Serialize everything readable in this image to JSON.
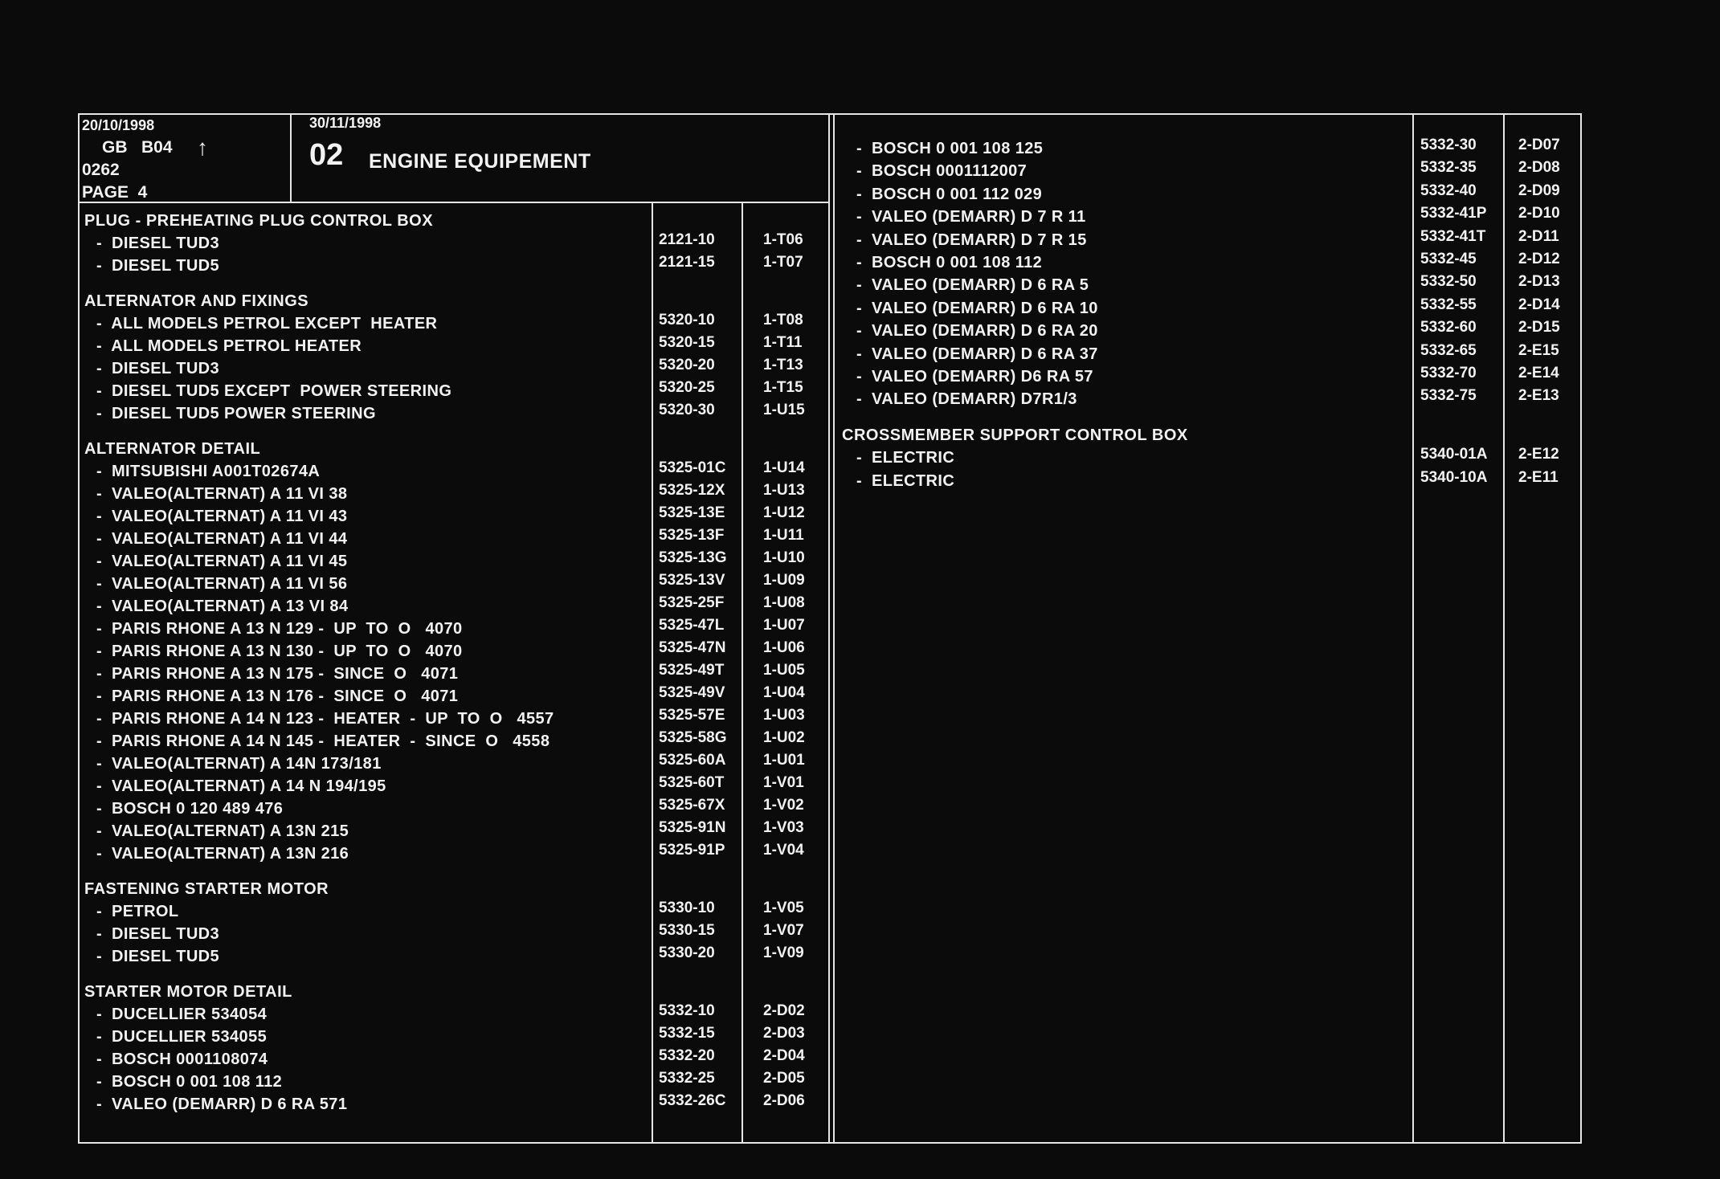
{
  "header": {
    "date_left": "20/10/1998",
    "lang_line": "GB   B04",
    "arrow": "↑",
    "code": "0262",
    "page": "PAGE  4",
    "date_right": "30/11/1998",
    "section_num": "02",
    "section_title": "ENGINE EQUIPEMENT"
  },
  "left_column": [
    {
      "type": "section",
      "text": "PLUG - PREHEATING PLUG CONTROL BOX"
    },
    {
      "type": "item",
      "text": "-  DIESEL TUD3",
      "ref": "2121-10",
      "code": "1-T06"
    },
    {
      "type": "item",
      "text": "-  DIESEL TUD5",
      "ref": "2121-15",
      "code": "1-T07"
    },
    {
      "type": "section",
      "text": "ALTERNATOR AND FIXINGS"
    },
    {
      "type": "item",
      "text": "-  ALL MODELS PETROL EXCEPT  HEATER",
      "ref": "5320-10",
      "code": "1-T08"
    },
    {
      "type": "item",
      "text": "-  ALL MODELS PETROL HEATER",
      "ref": "5320-15",
      "code": "1-T11"
    },
    {
      "type": "item",
      "text": "-  DIESEL TUD3",
      "ref": "5320-20",
      "code": "1-T13"
    },
    {
      "type": "item",
      "text": "-  DIESEL TUD5 EXCEPT  POWER STEERING",
      "ref": "5320-25",
      "code": "1-T15"
    },
    {
      "type": "item",
      "text": "-  DIESEL TUD5 POWER STEERING",
      "ref": "5320-30",
      "code": "1-U15"
    },
    {
      "type": "section",
      "text": "ALTERNATOR DETAIL"
    },
    {
      "type": "item",
      "text": "-  MITSUBISHI A001T02674A",
      "ref": "5325-01C",
      "code": "1-U14"
    },
    {
      "type": "item",
      "text": "-  VALEO(ALTERNAT) A 11 VI 38",
      "ref": "5325-12X",
      "code": "1-U13"
    },
    {
      "type": "item",
      "text": "-  VALEO(ALTERNAT) A 11 VI 43",
      "ref": "5325-13E",
      "code": "1-U12"
    },
    {
      "type": "item",
      "text": "-  VALEO(ALTERNAT) A 11 VI 44",
      "ref": "5325-13F",
      "code": "1-U11"
    },
    {
      "type": "item",
      "text": "-  VALEO(ALTERNAT) A 11 VI 45",
      "ref": "5325-13G",
      "code": "1-U10"
    },
    {
      "type": "item",
      "text": "-  VALEO(ALTERNAT) A 11 VI 56",
      "ref": "5325-13V",
      "code": "1-U09"
    },
    {
      "type": "item",
      "text": "-  VALEO(ALTERNAT) A 13 VI 84",
      "ref": "5325-25F",
      "code": "1-U08"
    },
    {
      "type": "item",
      "text": "-  PARIS RHONE A 13 N 129 -  UP  TO  O   4070",
      "ref": "5325-47L",
      "code": "1-U07"
    },
    {
      "type": "item",
      "text": "-  PARIS RHONE A 13 N 130 -  UP  TO  O   4070",
      "ref": "5325-47N",
      "code": "1-U06"
    },
    {
      "type": "item",
      "text": "-  PARIS RHONE A 13 N 175 -  SINCE  O   4071",
      "ref": "5325-49T",
      "code": "1-U05"
    },
    {
      "type": "item",
      "text": "-  PARIS RHONE A 13 N 176 -  SINCE  O   4071",
      "ref": "5325-49V",
      "code": "1-U04"
    },
    {
      "type": "item",
      "text": "-  PARIS RHONE A 14 N 123 -  HEATER  -  UP  TO  O   4557",
      "ref": "5325-57E",
      "code": "1-U03"
    },
    {
      "type": "item",
      "text": "-  PARIS RHONE A 14 N 145 -  HEATER  -  SINCE  O   4558",
      "ref": "5325-58G",
      "code": "1-U02"
    },
    {
      "type": "item",
      "text": "-  VALEO(ALTERNAT) A 14N 173/181",
      "ref": "5325-60A",
      "code": "1-U01"
    },
    {
      "type": "item",
      "text": "-  VALEO(ALTERNAT) A 14 N 194/195",
      "ref": "5325-60T",
      "code": "1-V01"
    },
    {
      "type": "item",
      "text": "-  BOSCH 0 120 489 476",
      "ref": "5325-67X",
      "code": "1-V02"
    },
    {
      "type": "item",
      "text": "-  VALEO(ALTERNAT) A 13N 215",
      "ref": "5325-91N",
      "code": "1-V03"
    },
    {
      "type": "item",
      "text": "-  VALEO(ALTERNAT) A 13N 216",
      "ref": "5325-91P",
      "code": "1-V04"
    },
    {
      "type": "section",
      "text": "FASTENING STARTER MOTOR"
    },
    {
      "type": "item",
      "text": "-  PETROL",
      "ref": "5330-10",
      "code": "1-V05"
    },
    {
      "type": "item",
      "text": "-  DIESEL TUD3",
      "ref": "5330-15",
      "code": "1-V07"
    },
    {
      "type": "item",
      "text": "-  DIESEL TUD5",
      "ref": "5330-20",
      "code": "1-V09"
    },
    {
      "type": "section",
      "text": "STARTER MOTOR DETAIL"
    },
    {
      "type": "item",
      "text": "-  DUCELLIER 534054",
      "ref": "5332-10",
      "code": "2-D02"
    },
    {
      "type": "item",
      "text": "-  DUCELLIER 534055",
      "ref": "5332-15",
      "code": "2-D03"
    },
    {
      "type": "item",
      "text": "-  BOSCH 0001108074",
      "ref": "5332-20",
      "code": "2-D04"
    },
    {
      "type": "item",
      "text": "-  BOSCH 0 001 108 112",
      "ref": "5332-25",
      "code": "2-D05"
    },
    {
      "type": "item",
      "text": "-  VALEO (DEMARR) D 6 RA 571",
      "ref": "5332-26C",
      "code": "2-D06"
    }
  ],
  "right_column": [
    {
      "type": "item",
      "text": "-  BOSCH 0 001 108 125",
      "ref": "5332-30",
      "code": "2-D07"
    },
    {
      "type": "item",
      "text": "-  BOSCH 0001112007",
      "ref": "5332-35",
      "code": "2-D08"
    },
    {
      "type": "item",
      "text": "-  BOSCH 0 001 112 029",
      "ref": "5332-40",
      "code": "2-D09"
    },
    {
      "type": "item",
      "text": "-  VALEO (DEMARR) D 7 R 11",
      "ref": "5332-41P",
      "code": "2-D10"
    },
    {
      "type": "item",
      "text": "-  VALEO (DEMARR) D 7 R 15",
      "ref": "5332-41T",
      "code": "2-D11"
    },
    {
      "type": "item",
      "text": "-  BOSCH 0 001 108 112",
      "ref": "5332-45",
      "code": "2-D12"
    },
    {
      "type": "item",
      "text": "-  VALEO (DEMARR) D 6 RA 5",
      "ref": "5332-50",
      "code": "2-D13"
    },
    {
      "type": "item",
      "text": "-  VALEO (DEMARR) D 6 RA 10",
      "ref": "5332-55",
      "code": "2-D14"
    },
    {
      "type": "item",
      "text": "-  VALEO (DEMARR) D 6 RA 20",
      "ref": "5332-60",
      "code": "2-D15"
    },
    {
      "type": "item",
      "text": "-  VALEO (DEMARR) D 6 RA 37",
      "ref": "5332-65",
      "code": "2-E15"
    },
    {
      "type": "item",
      "text": "-  VALEO (DEMARR) D6 RA 57",
      "ref": "5332-70",
      "code": "2-E14"
    },
    {
      "type": "item",
      "text": "-  VALEO (DEMARR) D7R1/3",
      "ref": "5332-75",
      "code": "2-E13"
    },
    {
      "type": "section",
      "text": "CROSSMEMBER SUPPORT CONTROL BOX"
    },
    {
      "type": "item",
      "text": "-  ELECTRIC",
      "ref": "5340-01A",
      "code": "2-E12"
    },
    {
      "type": "item",
      "text": "-  ELECTRIC",
      "ref": "5340-10A",
      "code": "2-E11"
    }
  ]
}
